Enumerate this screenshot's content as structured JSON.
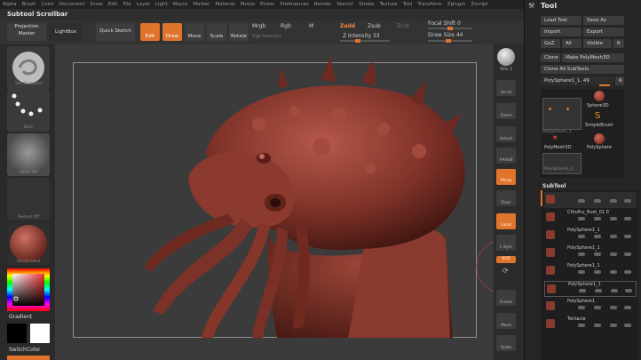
{
  "menu": [
    "Alpha",
    "Brush",
    "Color",
    "Document",
    "Draw",
    "Edit",
    "File",
    "Layer",
    "Light",
    "Macro",
    "Marker",
    "Material",
    "Movie",
    "Picker",
    "Preferences",
    "Render",
    "Stencil",
    "Stroke",
    "Texture",
    "Tool",
    "Transform",
    "Zplugin",
    "Zscript"
  ],
  "title": "Subtool Scrollbar",
  "toolbar": {
    "projection_master": "Projection Master",
    "lightbox": "LightBox",
    "quick_sketch": "Quick Sketch",
    "edit": "Edit",
    "draw": "Draw",
    "move": "Move",
    "scale": "Scale",
    "rotate": "Rotate",
    "mrgb": "Mrgb",
    "rgb": "Rgb",
    "m": "M",
    "rgb_intensity": "Rgb Intensity",
    "zadd": "Zadd",
    "zsub": "Zsub",
    "zcut": "Zcut",
    "z_intensity_label": "Z Intensity",
    "z_intensity_value": "33",
    "focal_shift_label": "Focal Shift",
    "focal_shift_value": "0",
    "draw_size_label": "Draw Size",
    "draw_size_value": "44",
    "z_intensity_level": 0.33,
    "focal_shift_level": 0.5,
    "draw_size_level": 0.45
  },
  "left_shelf": {
    "brush_caption": "Std_Standard",
    "stroke_caption": "Dots",
    "alpha_caption": "Alpha Off",
    "texture_caption": "Texture Off",
    "material_caption": "SkinShade4",
    "gradient_label": "Gradient",
    "switchcolor_label": "SwitchColor"
  },
  "right_shelf": {
    "spix_label": "SPix",
    "spix_value": "3",
    "scroll": "Scroll",
    "zoom": "Zoom",
    "actual": "Actual",
    "aahalf": "AAHalf",
    "persp": "Persp",
    "floor": "Floor",
    "local": "Local",
    "lsym": "L.Sym",
    "xyz": "XYZ",
    "frame": "Frame",
    "move": "Move",
    "scale": "Scale"
  },
  "tool_panel": {
    "title": "Tool",
    "load_tool": "Load Tool",
    "save_as": "Save As",
    "import": "Import",
    "export": "Export",
    "goz": "GoZ",
    "all": "All",
    "visible": "Visible",
    "r": "R",
    "clone": "Clone",
    "make_polymesh": "Make PolyMesh3D",
    "clone_all": "Clone All SubTools",
    "current_tool": "PolySphere1_1. 49",
    "r2": "R",
    "tools": [
      {
        "name": "PolySphere1_1"
      },
      {
        "name": "Sphere3D"
      },
      {
        "name": "SimpleBrush"
      },
      {
        "name": "PolyMesh3D"
      },
      {
        "name": "PolySphere"
      },
      {
        "name": "PolySphere1_1"
      }
    ],
    "subtool_label": "SubTool",
    "subtools": [
      {
        "name": ""
      },
      {
        "name": "Cthulhu_Bust_01 0"
      },
      {
        "name": "PolySphere1_1"
      },
      {
        "name": "PolySphere1_1"
      },
      {
        "name": "PolySphere1_1"
      },
      {
        "name": "PolySphere1_1"
      },
      {
        "name": "PolySphere1"
      },
      {
        "name": "Tentacle"
      }
    ]
  },
  "colors": {
    "accent": "#e0742c",
    "model": "#8a3a30",
    "viewport": "#3b3b3b"
  }
}
